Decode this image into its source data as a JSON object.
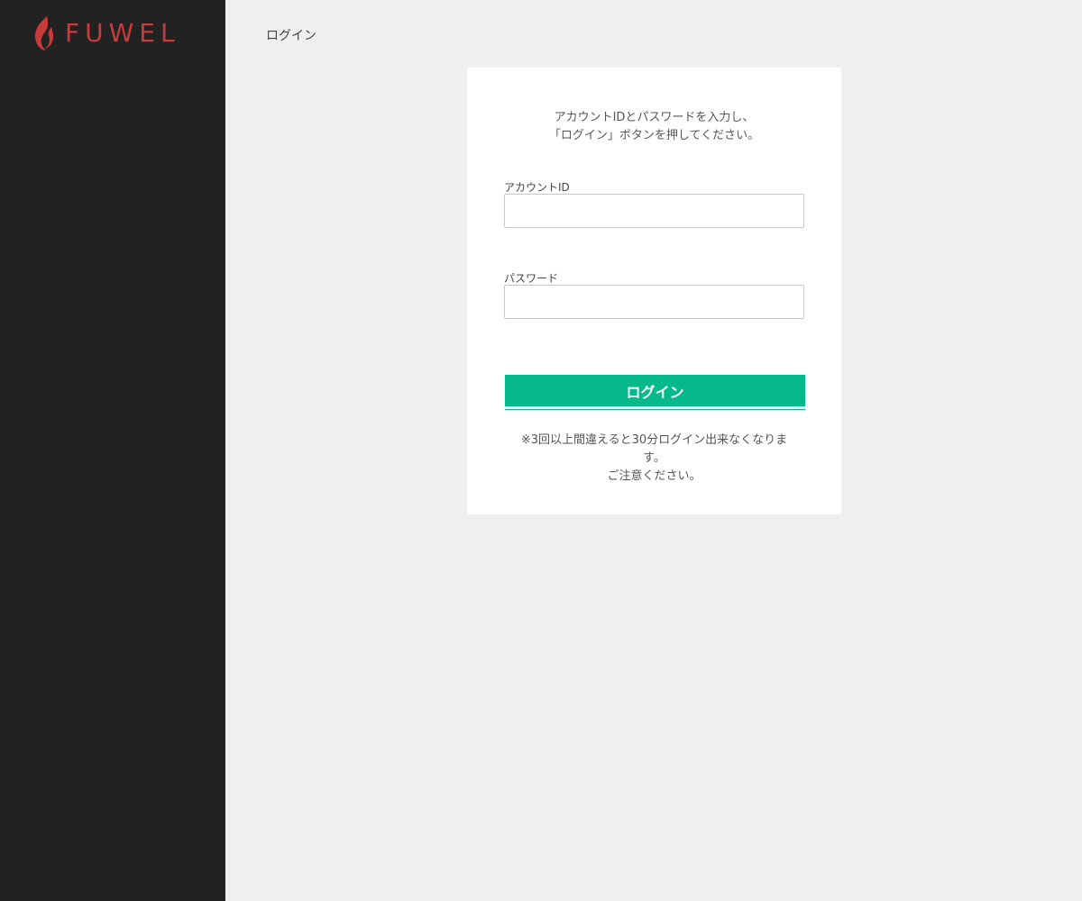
{
  "brand": {
    "name": "FUWEL",
    "logo_icon": "flame-icon",
    "color": "#c93a3a"
  },
  "colors": {
    "sidebar": "#222222",
    "background": "#efefef",
    "accent": "#05b98a"
  },
  "header": {
    "title": "ログイン"
  },
  "form": {
    "intro_line1": "アカウントIDとパスワードを入力し、",
    "intro_line2": "「ログイン」ボタンを押してください。",
    "account_label": "アカウントID",
    "account_value": "",
    "account_placeholder": "",
    "password_label": "パスワード",
    "password_value": "",
    "password_placeholder": "",
    "login_button": "ログイン",
    "note_line1": "※3回以上間違えると30分ログイン出来なくなりま",
    "note_line2": "す。",
    "note_line3": "ご注意ください。"
  }
}
